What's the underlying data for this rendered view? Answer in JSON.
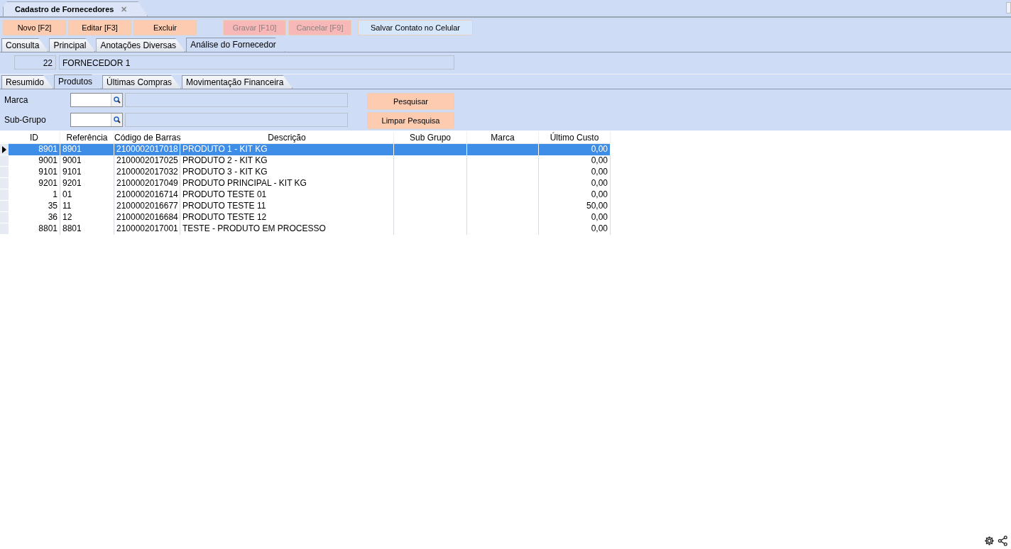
{
  "document_tab": {
    "title": "Cadastro de Fornecedores",
    "close": "✕"
  },
  "toolbar": [
    {
      "label": "Novo [F2]",
      "kind": "action",
      "disabled": false
    },
    {
      "label": "Editar [F3]",
      "kind": "action",
      "disabled": false
    },
    {
      "label": "Excluir",
      "kind": "action",
      "disabled": false
    },
    {
      "label": "Gravar [F10]",
      "kind": "action",
      "disabled": true
    },
    {
      "label": "Cancelar [F9]",
      "kind": "action",
      "disabled": true
    },
    {
      "label": "Salvar Contato no Celular",
      "kind": "secondary",
      "disabled": false
    }
  ],
  "main_tabs": [
    {
      "label": "Consulta",
      "selected": false
    },
    {
      "label": "Principal",
      "selected": false
    },
    {
      "label": "Anotações Diversas",
      "selected": false
    },
    {
      "label": "Análise do Fornecedor",
      "selected": true
    }
  ],
  "supplier": {
    "code": "22",
    "name": "FORNECEDOR 1"
  },
  "sub_tabs": [
    {
      "label": "Resumido",
      "selected": false
    },
    {
      "label": "Produtos",
      "selected": true
    },
    {
      "label": "Últimas Compras",
      "selected": false
    },
    {
      "label": "Movimentação Financeira",
      "selected": false
    }
  ],
  "filters": [
    {
      "label": "Marca"
    },
    {
      "label": "Sub-Grupo"
    }
  ],
  "filter_buttons": [
    "Pesquisar",
    "Limpar Pesquisa"
  ],
  "table": {
    "columns": [
      "ID",
      "Referência",
      "Código de Barras",
      "Descrição",
      "Sub Grupo",
      "Marca",
      "Último Custo"
    ],
    "rows": [
      {
        "cells": [
          "8901",
          "8901",
          "2100002017018",
          "PRODUTO 1 -  KIT KG",
          "",
          "",
          "0,00"
        ],
        "selected": true
      },
      {
        "cells": [
          "9001",
          "9001",
          "2100002017025",
          "PRODUTO 2 -  KIT KG",
          "",
          "",
          "0,00"
        ],
        "selected": false
      },
      {
        "cells": [
          "9101",
          "9101",
          "2100002017032",
          "PRODUTO 3 -  KIT KG",
          "",
          "",
          "0,00"
        ],
        "selected": false
      },
      {
        "cells": [
          "9201",
          "9201",
          "2100002017049",
          "PRODUTO PRINCIPAL -  KIT KG",
          "",
          "",
          "0,00"
        ],
        "selected": false
      },
      {
        "cells": [
          "1",
          "01",
          "2100002016714",
          "PRODUTO TESTE 01",
          "",
          "",
          "0,00"
        ],
        "selected": false
      },
      {
        "cells": [
          "35",
          "11",
          "2100002016677",
          "PRODUTO TESTE 11",
          "",
          "",
          "50,00"
        ],
        "selected": false
      },
      {
        "cells": [
          "36",
          "12",
          "2100002016684",
          "PRODUTO TESTE 12",
          "",
          "",
          "0,00"
        ],
        "selected": false
      },
      {
        "cells": [
          "8801",
          "8801",
          "2100002017001",
          "TESTE - PRODUTO EM PROCESSO",
          "",
          "",
          "0,00"
        ],
        "selected": false
      }
    ]
  }
}
